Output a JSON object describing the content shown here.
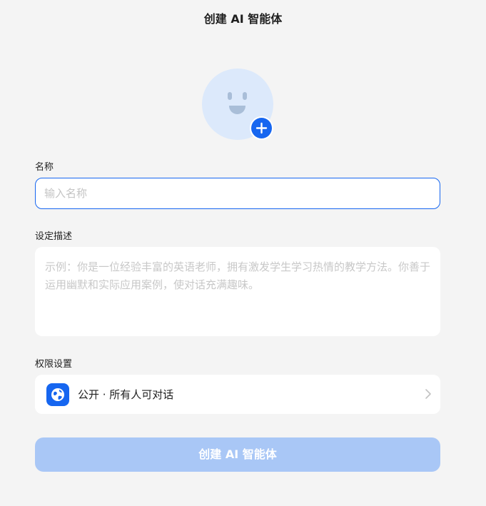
{
  "header": {
    "title": "创建 AI 智能体"
  },
  "avatar": {
    "icon": "smiley-face-icon",
    "add_icon": "plus-icon"
  },
  "name": {
    "label": "名称",
    "placeholder": "输入名称",
    "value": ""
  },
  "description": {
    "label": "设定描述",
    "placeholder": "示例：你是一位经验丰富的英语老师，拥有激发学生学习热情的教学方法。你善于运用幽默和实际应用案例，使对话充满趣味。",
    "value": ""
  },
  "permission": {
    "label": "权限设置",
    "icon": "globe-icon",
    "value": "公开 · 所有人可对话"
  },
  "create_button": {
    "label": "创建 AI 智能体",
    "state": "disabled"
  },
  "colors": {
    "accent": "#1666f0",
    "button_disabled": "#a9c7f6",
    "avatar_bg": "#dce9fb",
    "page_bg": "#f4f4f4"
  }
}
